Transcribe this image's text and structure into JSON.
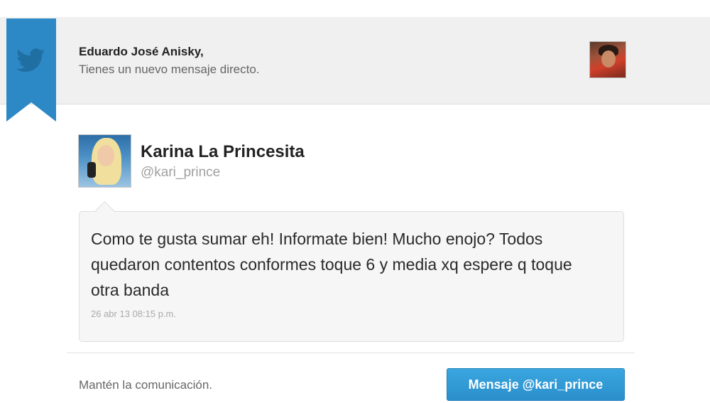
{
  "header": {
    "recipient_name": "Eduardo José Anisky,",
    "subtitle": "Tienes un nuevo mensaje directo.",
    "ribbon_color": "#2d88c6",
    "bird_color": "#1f6fa3"
  },
  "message": {
    "sender_name": "Karina La Princesita",
    "sender_handle": "@kari_prince",
    "text": "Como te gusta sumar eh! Informate bien! Mucho enojo? Todos quedaron contentos conformes toque 6 y media xq espere q toque otra banda",
    "timestamp": "26 abr 13 08:15 p.m."
  },
  "footer": {
    "prompt": "Mantén la comunicación.",
    "reply_button_label": "Mensaje @kari_prince",
    "button_color": "#2a9bd8"
  }
}
